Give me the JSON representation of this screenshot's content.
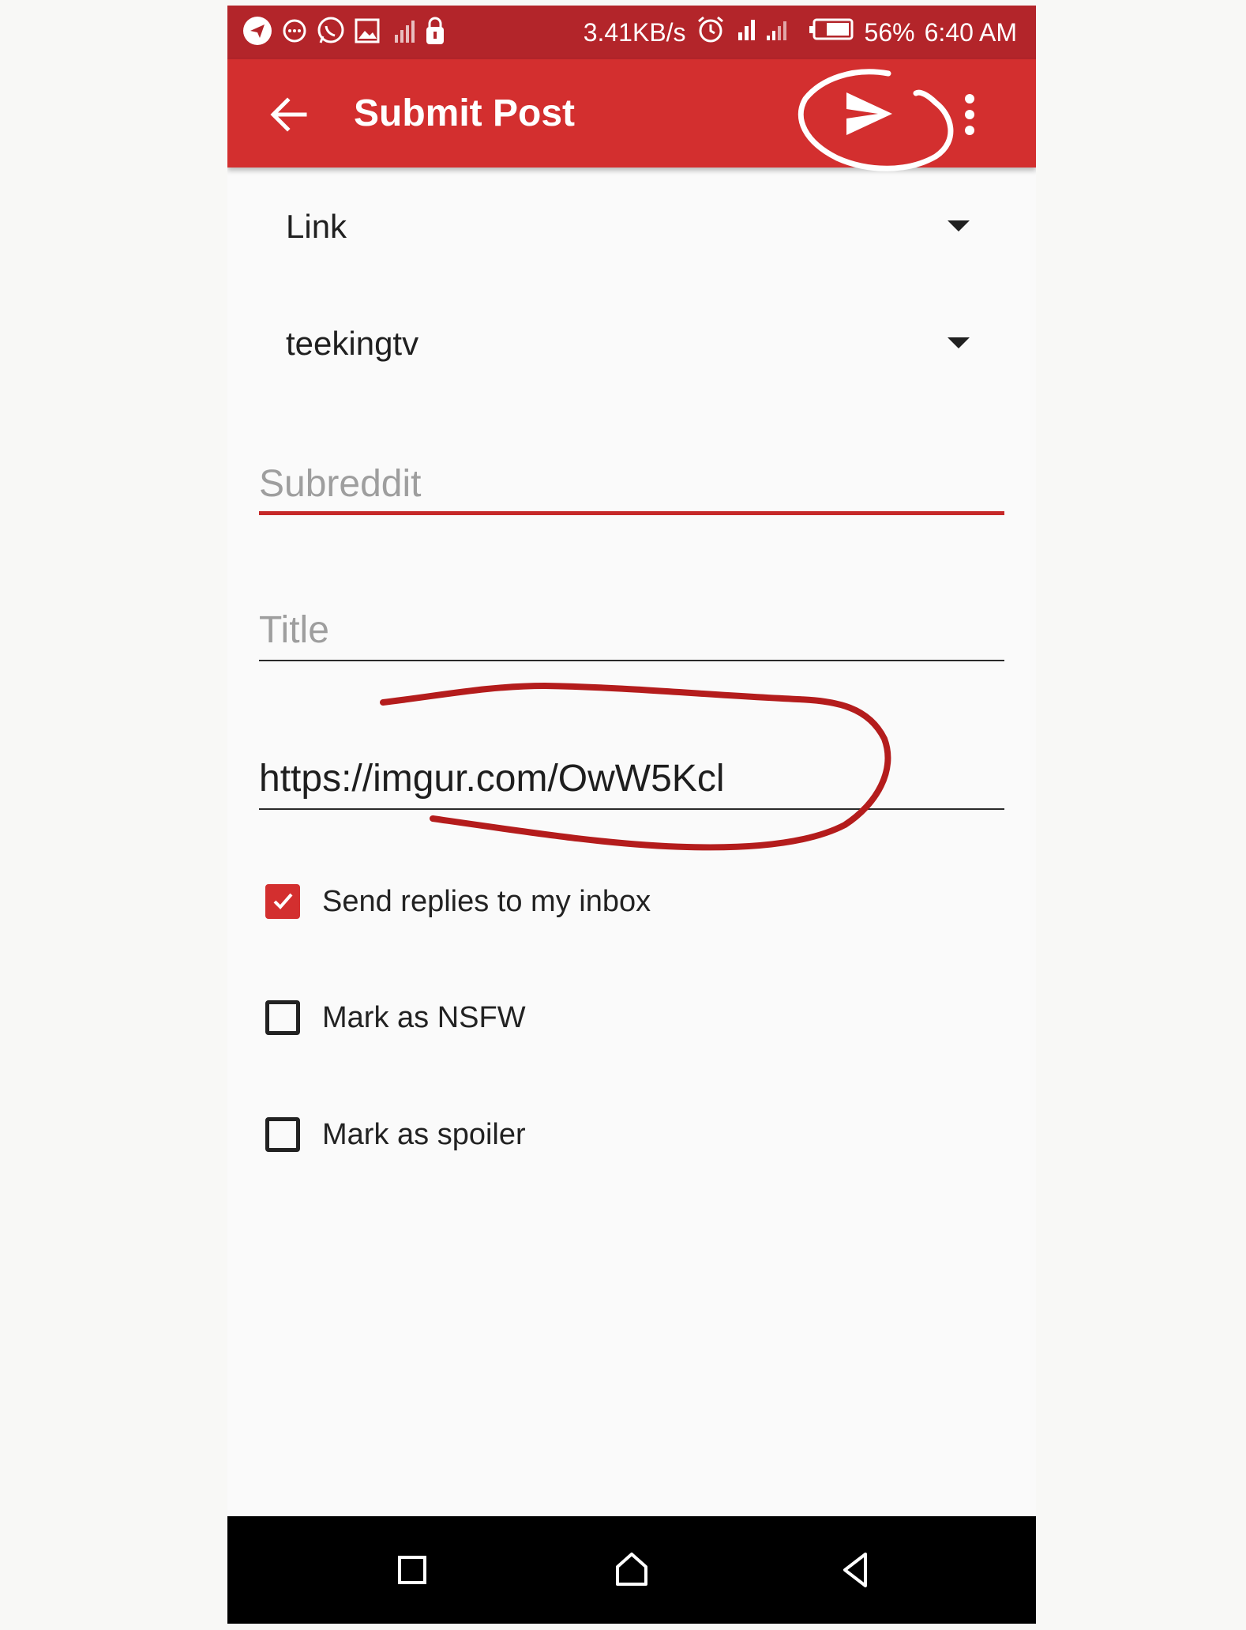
{
  "status_bar": {
    "speed": "3.41KB/s",
    "battery": "56%",
    "time": "6:40 AM",
    "icons": [
      "telegram-icon",
      "chat-icon",
      "whatsapp-icon",
      "gallery-icon",
      "signal-icon",
      "lock-icon",
      "alarm-icon",
      "mobile-data-icon",
      "battery-icon"
    ]
  },
  "app_bar": {
    "title": "Submit Post",
    "icons": [
      "back-arrow-icon",
      "send-icon",
      "more-vert-icon"
    ]
  },
  "form": {
    "post_type": "Link",
    "account": "teekingtv",
    "subreddit_placeholder": "Subreddit",
    "title_placeholder": "Title",
    "url_value": "https://imgur.com/OwW5Kcl"
  },
  "options": [
    {
      "label": "Send replies to my inbox",
      "checked": true
    },
    {
      "label": "Mark as NSFW",
      "checked": false
    },
    {
      "label": "Mark as spoiler",
      "checked": false
    }
  ],
  "colors": {
    "status_bar": "#b3252a",
    "app_bar": "#d32f2f",
    "accent": "#c62828",
    "annotation_white": "#ffffff",
    "annotation_red": "#b41c1c"
  },
  "nav_bar": {
    "icons": [
      "recents-icon",
      "home-icon",
      "back-icon"
    ]
  }
}
